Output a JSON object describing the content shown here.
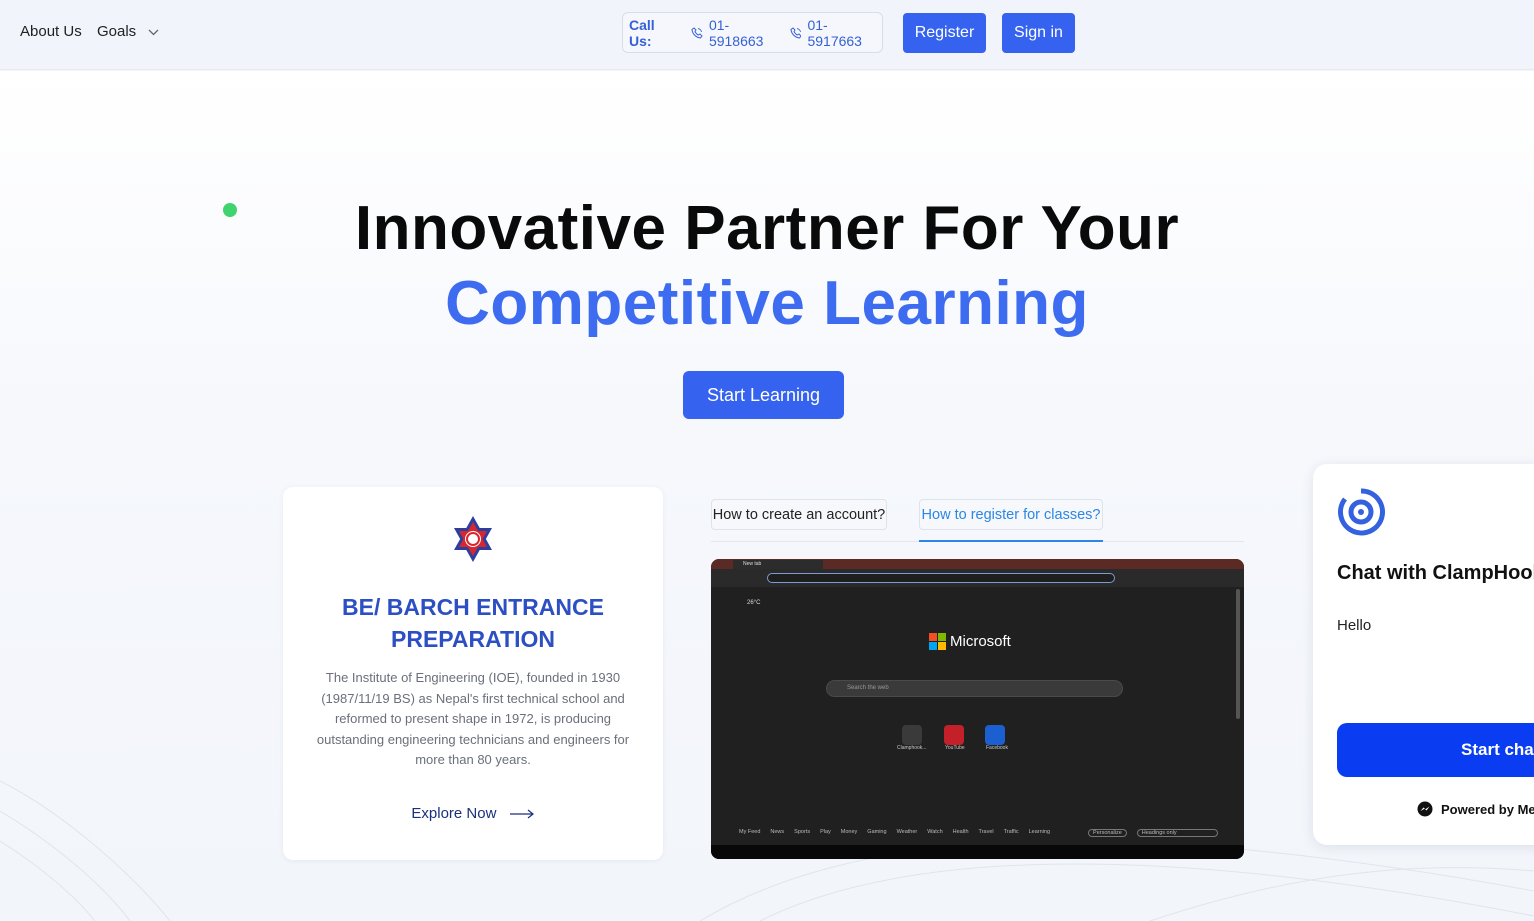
{
  "nav": {
    "about": "About Us",
    "goals": "Goals"
  },
  "contact": {
    "label": "Call Us:",
    "phone1": "01-5918663",
    "phone2": "01-5917663"
  },
  "auth": {
    "register": "Register",
    "signin": "Sign in"
  },
  "hero": {
    "line1": "Innovative Partner For Your",
    "line2": "Competitive Learning",
    "cta": "Start Learning"
  },
  "course_card": {
    "title": "BE/ BARCH ENTRANCE PREPARATION",
    "description": "The Institute of Engineering (IOE), founded in 1930 (1987/11/19 BS) as Nepal's first technical school and reformed to present shape in 1972, is producing outstanding engineering technicians and engineers for more than 80 years.",
    "link": "Explore Now"
  },
  "tutorial_tabs": [
    {
      "label": "How to create an account?",
      "active": false
    },
    {
      "label": "How to register for classes?",
      "active": true
    }
  ],
  "video_preview": {
    "tab_title": "New tab",
    "brand": "Microsoft",
    "weather": "26°C",
    "search_placeholder": "Search the web",
    "tiles": [
      "Clamphook...",
      "YouTube",
      "Facebook"
    ],
    "feed": [
      "My Feed",
      "News",
      "Sports",
      "Play",
      "Money",
      "Gaming",
      "Weather",
      "Watch",
      "Health",
      "Travel",
      "Traffic",
      "Learning"
    ],
    "personalize": "Personalize",
    "layout": "Headings only"
  },
  "chat_widget": {
    "title": "Chat with ClampHool",
    "message": "Hello",
    "button": "Start cha",
    "powered": "Powered by Me"
  },
  "colors": {
    "primary": "#3563f0",
    "heading_accent": "#3d6cf0",
    "chat_button": "#0a3cf2",
    "status_dot": "#3fd46e"
  }
}
